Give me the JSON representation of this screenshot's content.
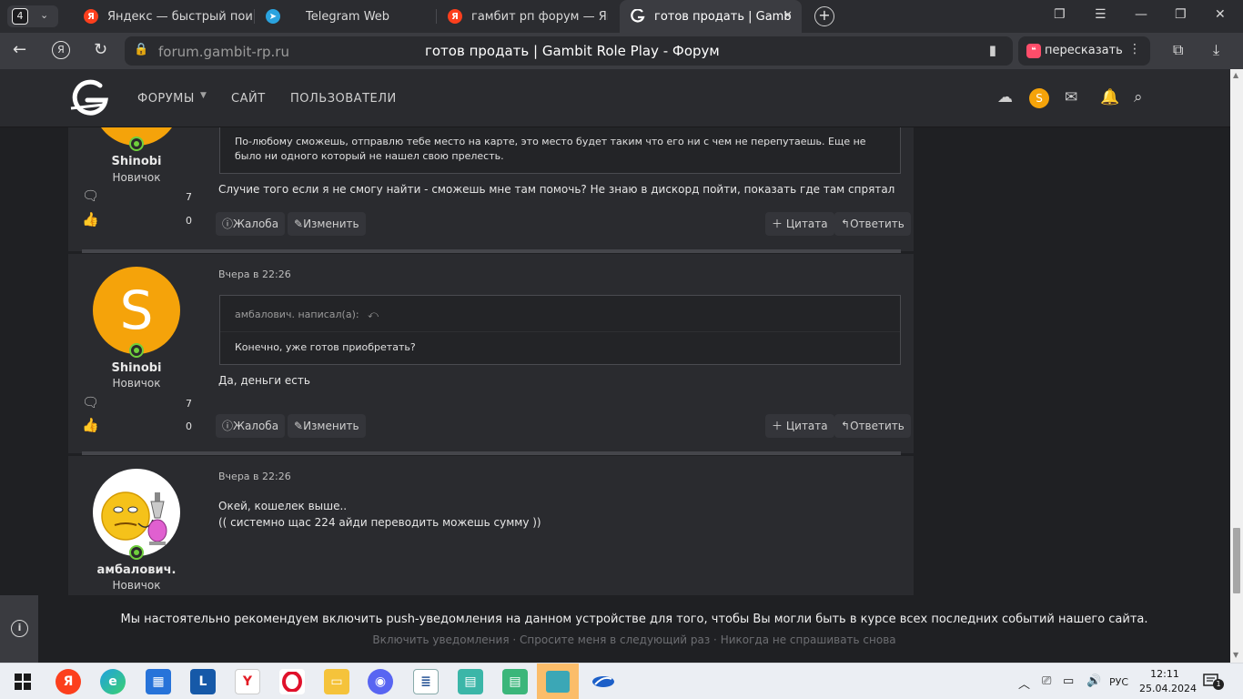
{
  "browser": {
    "tab_count": "4",
    "tabs": [
      {
        "label": "Яндекс — быстрый поиск",
        "favicon": "yandex-icon"
      },
      {
        "label": "Telegram Web",
        "favicon": "telegram-icon"
      },
      {
        "label": "гамбит рп форум — Яндекс",
        "favicon": "yandex-icon"
      },
      {
        "label": "готов продать | Gambit Role Play - Форум",
        "favicon": "gambit-icon",
        "active": true
      }
    ],
    "url": "forum.gambit-rp.ru",
    "page_title": "готов продать | Gambit Role Play - Форум",
    "retell_label": "пересказать"
  },
  "forum_nav": {
    "forums": "ФОРУМЫ",
    "site": "САЙТ",
    "users": "ПОЛЬЗОВАТЕЛИ",
    "avatar_letter": "S"
  },
  "posts": [
    {
      "username": "Shinobi",
      "role": "Новичок",
      "messages_count": "7",
      "likes_count": "0",
      "quote_body": "По-любому сможешь, отправлю тебе место на карте, это место будет таким что его ни с чем не перепутаешь. Еще не было ни одного который не нашел свою прелесть.",
      "message": "Случие того если я не смогу найти - сможешь мне там помочь? Не знаю в дискорд пойти, показать где там спрятал",
      "actions": {
        "report": "Жалоба",
        "edit": "Изменить",
        "quote": "Цитата",
        "reply": "Ответить"
      }
    },
    {
      "username": "Shinobi",
      "role": "Новичок",
      "avatar_letter": "S",
      "date": "Вчера в 22:26",
      "messages_count": "7",
      "likes_count": "0",
      "quote_author": "амбалович. написал(а):",
      "quote_body": "Конечно, уже готов приобретать?",
      "message": "Да, деньги есть",
      "actions": {
        "report": "Жалоба",
        "edit": "Изменить",
        "quote": "Цитата",
        "reply": "Ответить"
      }
    },
    {
      "username": "амбалович.",
      "role": "Новичок",
      "date": "Вчера в 22:26",
      "message_line1": "Окей, кошелек выше..",
      "message_line2": "(( системно щас 224 айди переводить можешь сумму ))"
    }
  ],
  "push_notice": {
    "text": "Мы настоятельно рекомендуем включить push-уведомления на данном устройстве для того, чтобы Вы могли быть в курсе всех последних событий нашего сайта.",
    "enable": "Включить уведомления",
    "later": "Спросите меня в следующий раз",
    "never": "Никогда не спрашивать снова",
    "sep": "·"
  },
  "taskbar": {
    "lang": "РУС",
    "time": "12:11",
    "date": "25.04.2024",
    "notif_count": "1",
    "apps": [
      "windows-start-icon",
      "yandex-browser-icon",
      "edge-icon",
      "store-icon",
      "l-app-icon",
      "yandex-y-icon",
      "opera-icon",
      "file-explorer-icon",
      "discord-icon",
      "notepad-icon",
      "app-icon-1",
      "app-icon-2",
      "app-icon-3",
      "app-icon-4"
    ]
  },
  "colors": {
    "accent": "#f5a30a",
    "online": "#6fcf3d",
    "background": "#1f2023",
    "panel": "#2a2b2f"
  }
}
